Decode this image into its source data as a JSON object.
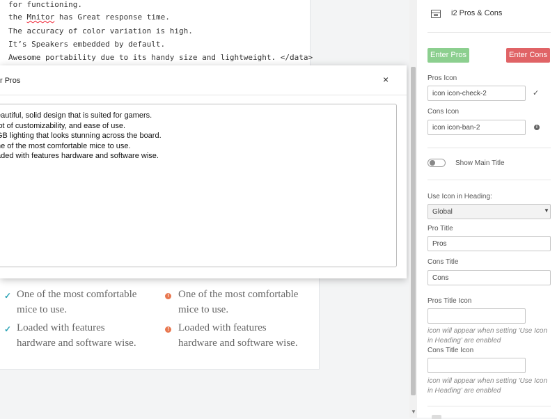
{
  "code": {
    "lines": [
      "for functioning.",
      "the ",
      "It’s Speakers embedded by default.",
      "Awesome portability due to its handy size and lightweight. </data>"
    ],
    "line2_word": "Mnitor",
    "line2_rest": " has Great response time.",
    "line3": "The accuracy of color variation is high."
  },
  "content": {
    "pros_top_faded": "stunning across the board.",
    "cons_top_faded": "stunning across the board.",
    "pros": [
      {
        "line1": "One of the most comfortable",
        "line2": "mice to use."
      },
      {
        "line1": "Loaded with features",
        "line2": "hardware and software wise."
      }
    ],
    "cons": [
      {
        "line1": "One of the most comfortable",
        "line2": "mice to use."
      },
      {
        "line1": "Loaded with features",
        "line2": "hardware and software wise."
      }
    ],
    "check_glyph": "✓",
    "warn_glyph": "!"
  },
  "modal": {
    "title": "r Pros",
    "close": "×",
    "lines": [
      "eautiful, solid design that is suited for gamers.",
      "lot of customizability, and ease of use.",
      "GB lighting that looks stunning across the board.",
      "ne of the most comfortable mice to use.",
      "aded with features hardware and software wise."
    ]
  },
  "panel": {
    "heading": "i2 Pros & Cons",
    "enter_pros": "Enter Pros",
    "enter_cons": "Enter Cons",
    "pros_icon_label": "Pros Icon",
    "pros_icon_value": "icon icon-check-2",
    "cons_icon_label": "Cons Icon",
    "cons_icon_value": "icon icon-ban-2",
    "check_glyph": "✓",
    "info_glyph": "i",
    "show_main_title": "Show Main Title",
    "use_icon_label": "Use Icon in Heading:",
    "use_icon_value": "Global",
    "select_arrow": "▼",
    "pro_title_label": "Pro Title",
    "pro_title_value": "Pros",
    "cons_title_label": "Cons Title",
    "cons_title_value": "Cons",
    "pros_title_icon_label": "Pros Title Icon",
    "pros_title_icon_hint_1": "icon will appear when setting 'Use Icon",
    "pros_title_icon_hint_2": "in Heading' are enabled",
    "cons_title_icon_label": "Cons Title Icon",
    "cons_title_icon_hint_1": "icon will appear when setting 'Use Icon",
    "cons_title_icon_hint_2": "in Heading' are enabled"
  },
  "scroll": {
    "down_arrow": "▼"
  },
  "colors": {
    "enter_pros_bg": "#8ccf8f",
    "enter_cons_bg": "#e06366",
    "check_icon": "#2aa3b5",
    "warn_icon": "#e8774f"
  }
}
